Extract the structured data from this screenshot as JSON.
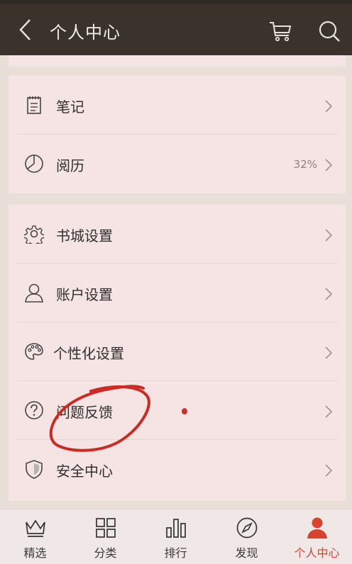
{
  "header": {
    "title": "个人中心",
    "back_icon": "back-arrow-icon",
    "cart_icon": "cart-icon",
    "search_icon": "search-icon"
  },
  "sections": {
    "reading": [
      {
        "id": "notes",
        "label": "笔记",
        "icon": "notepad-icon",
        "value": ""
      },
      {
        "id": "history",
        "label": "阅历",
        "icon": "pie-clock-icon",
        "value": "32%"
      }
    ],
    "settings": [
      {
        "id": "bookstore-settings",
        "label": "书城设置",
        "icon": "gear-icon"
      },
      {
        "id": "account-settings",
        "label": "账户设置",
        "icon": "user-icon"
      },
      {
        "id": "personalization-settings",
        "label": "个性化设置",
        "icon": "palette-icon"
      },
      {
        "id": "feedback",
        "label": "问题反馈",
        "icon": "question-icon"
      },
      {
        "id": "security-center",
        "label": "安全中心",
        "icon": "shield-icon"
      }
    ]
  },
  "tabbar": {
    "tabs": [
      {
        "label": "精选",
        "icon": "crown-icon",
        "active": false
      },
      {
        "label": "分类",
        "icon": "grid-icon",
        "active": false
      },
      {
        "label": "排行",
        "icon": "bar-chart-icon",
        "active": false
      },
      {
        "label": "发现",
        "icon": "compass-icon",
        "active": false
      },
      {
        "label": "个人中心",
        "icon": "person-icon",
        "active": true
      }
    ]
  },
  "colors": {
    "appbar": "#3a322b",
    "card": "#f5e4e3",
    "accent": "#d9432e",
    "annotation": "#c9302c"
  }
}
